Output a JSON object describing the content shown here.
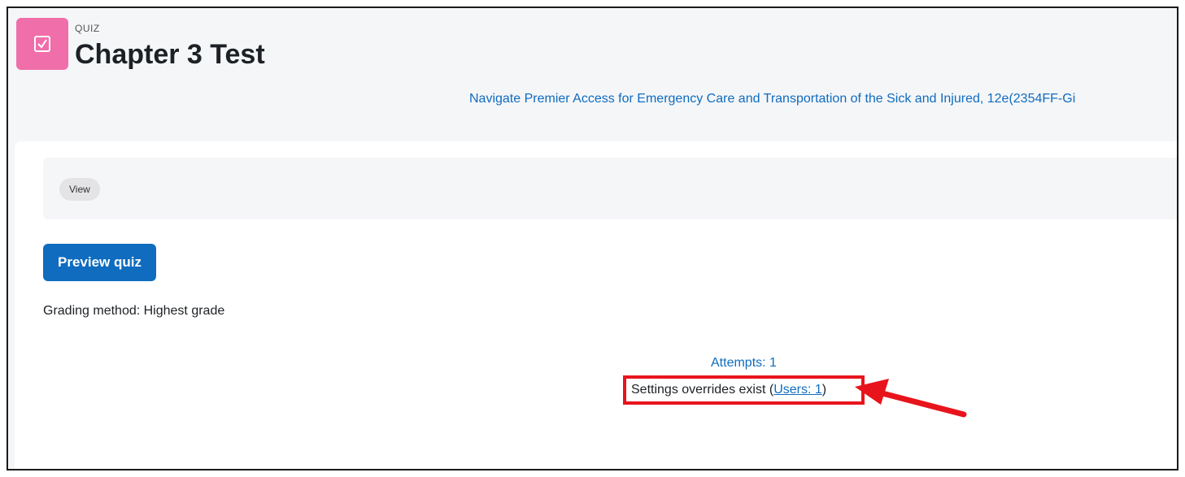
{
  "header": {
    "module_type": "QUIZ",
    "title": "Chapter 3 Test",
    "module_icon": "quiz-check-icon",
    "course_link": "Navigate Premier Access for Emergency Care and Transportation of the Sick and Injured, 12e(2354FF-Gi"
  },
  "nav": {
    "view_label": "View"
  },
  "main": {
    "preview_button": "Preview quiz",
    "grading_method": "Grading method: Highest grade",
    "attempts_link": "Attempts: 1",
    "overrides_text": "Settings overrides exist (",
    "overrides_link": "Users: 1",
    "overrides_close": ")"
  },
  "colors": {
    "accent": "#0f6cbf",
    "quiz_icon": "#f06eaa",
    "highlight": "#e8141c"
  }
}
